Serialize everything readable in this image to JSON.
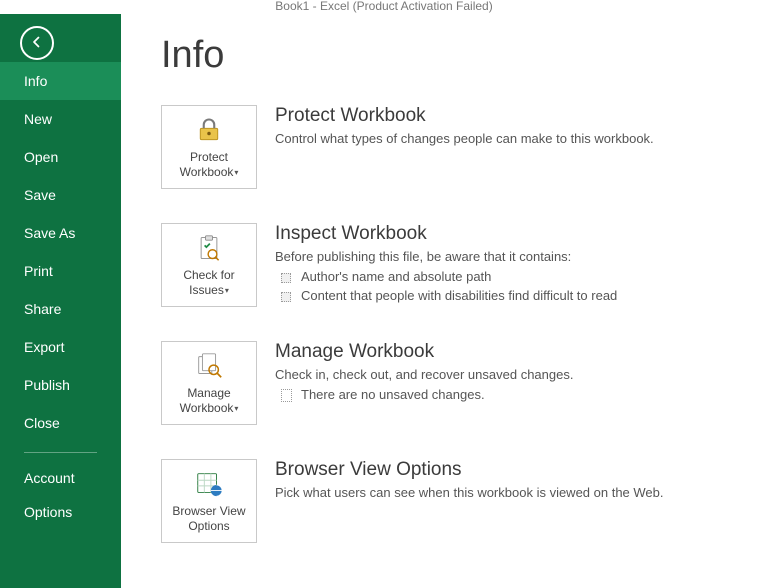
{
  "titlebar": "Book1 - Excel (Product Activation Failed)",
  "page_heading": "Info",
  "sidebar": {
    "items": [
      {
        "label": "Info",
        "active": true
      },
      {
        "label": "New"
      },
      {
        "label": "Open"
      },
      {
        "label": "Save"
      },
      {
        "label": "Save As"
      },
      {
        "label": "Print"
      },
      {
        "label": "Share"
      },
      {
        "label": "Export"
      },
      {
        "label": "Publish"
      },
      {
        "label": "Close"
      }
    ],
    "footer_items": [
      {
        "label": "Account"
      },
      {
        "label": "Options"
      }
    ]
  },
  "sections": {
    "protect": {
      "tile_label": "Protect Workbook",
      "heading": "Protect Workbook",
      "desc": "Control what types of changes people can make to this workbook."
    },
    "inspect": {
      "tile_label": "Check for Issues",
      "heading": "Inspect Workbook",
      "desc": "Before publishing this file, be aware that it contains:",
      "bullets": [
        "Author's name and absolute path",
        "Content that people with disabilities find difficult to read"
      ]
    },
    "manage": {
      "tile_label": "Manage Workbook",
      "heading": "Manage Workbook",
      "desc": "Check in, check out, and recover unsaved changes.",
      "bullets": [
        "There are no unsaved changes."
      ]
    },
    "browser": {
      "tile_label": "Browser View Options",
      "heading": "Browser View Options",
      "desc": "Pick what users can see when this workbook is viewed on the Web."
    }
  }
}
